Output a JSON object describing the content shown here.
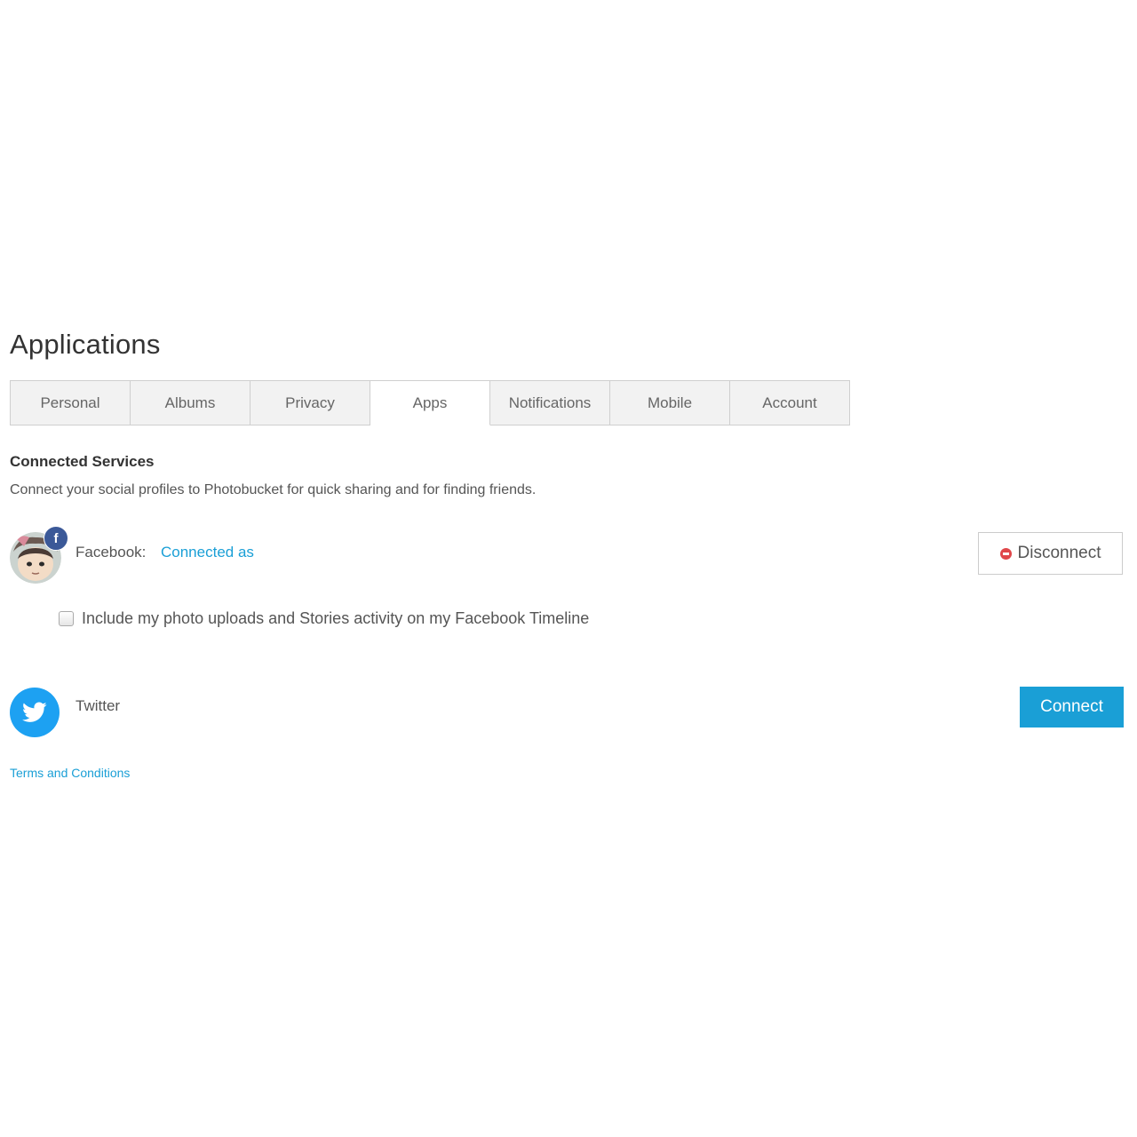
{
  "page": {
    "title": "Applications"
  },
  "tabs": [
    {
      "label": "Personal",
      "active": false
    },
    {
      "label": "Albums",
      "active": false
    },
    {
      "label": "Privacy",
      "active": false
    },
    {
      "label": "Apps",
      "active": true
    },
    {
      "label": "Notifications",
      "active": false
    },
    {
      "label": "Mobile",
      "active": false
    },
    {
      "label": "Account",
      "active": false
    }
  ],
  "connected_services": {
    "title": "Connected Services",
    "description": "Connect your social profiles to Photobucket for quick sharing and for finding friends."
  },
  "facebook": {
    "label": "Facebook:",
    "status": "Connected as",
    "badge_glyph": "f",
    "badge_icon": "facebook-icon",
    "disconnect_label": "Disconnect",
    "timeline_option": "Include my photo uploads and Stories activity on my Facebook Timeline",
    "timeline_checked": false
  },
  "twitter": {
    "label": "Twitter",
    "icon": "twitter-bird-icon",
    "connect_label": "Connect"
  },
  "footer": {
    "terms_link": "Terms and Conditions"
  },
  "colors": {
    "accent": "#1a9fd6",
    "facebook": "#3b5998",
    "twitter": "#1da1f2",
    "disconnect_icon": "#e0474a"
  }
}
